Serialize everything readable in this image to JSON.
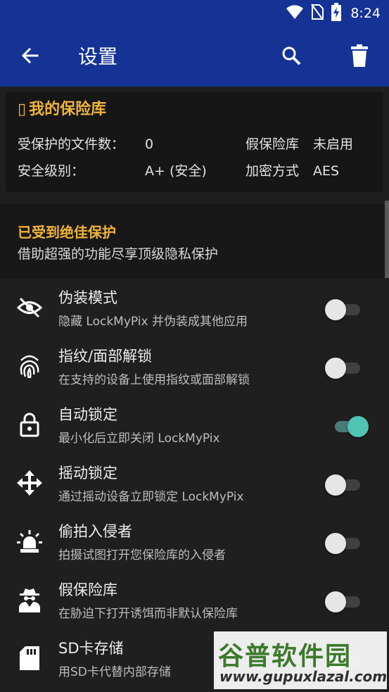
{
  "status_bar": {
    "time": "8:24",
    "icons": [
      "wifi-icon",
      "no-sim-icon",
      "battery-charging-icon"
    ]
  },
  "app_bar": {
    "title": "设置",
    "icons": [
      "arrow-back-icon",
      "search-icon",
      "delete-icon"
    ],
    "background": "#143394"
  },
  "vault": {
    "icon_glyph": "▯",
    "title": "我的保险库",
    "protected_files_label": "受保护的文件数：",
    "protected_files_value": "0",
    "security_level_label": "安全级别：",
    "security_level_value": "A+ (安全)",
    "fake_vault_label": "假保险库",
    "fake_vault_value": "未启用",
    "encryption_label": "加密方式",
    "encryption_value": "AES"
  },
  "promo": {
    "title": "已受到绝佳保护",
    "subtitle": "借助超强的功能尽享顶级隐私保护"
  },
  "settings": [
    {
      "label": "伪装模式",
      "desc": "隐藏 LockMyPix 并伪装成其他应用",
      "icon": "eye-off-icon",
      "enabled": false
    },
    {
      "label": "指纹/面部解锁",
      "desc": "在支持的设备上使用指纹或面部解锁",
      "icon": "fingerprint-icon",
      "enabled": false
    },
    {
      "label": "自动锁定",
      "desc": "最小化后立即关闭 LockMyPix",
      "icon": "lock-icon",
      "enabled": true
    },
    {
      "label": "摇动锁定",
      "desc": "通过摇动设备立即锁定 LockMyPix",
      "icon": "move-arrows-icon",
      "enabled": false
    },
    {
      "label": "偷拍入侵者",
      "desc": "拍摄试图打开您保险库的入侵者",
      "icon": "alarm-light-icon",
      "enabled": false
    },
    {
      "label": "假保险库",
      "desc": "在胁迫下打开诱饵而非默认保险库",
      "icon": "spy-icon",
      "enabled": false
    },
    {
      "label": "SD卡存储",
      "desc": "用SD卡代替内部存储",
      "icon": "sd-card-icon",
      "enabled": false
    }
  ],
  "watermark": {
    "title": "谷普软件园",
    "url": "www.gupuxlazal.com"
  },
  "colors": {
    "accent_gold": "#f0b53a",
    "switch_on": "#4fc4b5",
    "background": "#1f1f1f"
  }
}
